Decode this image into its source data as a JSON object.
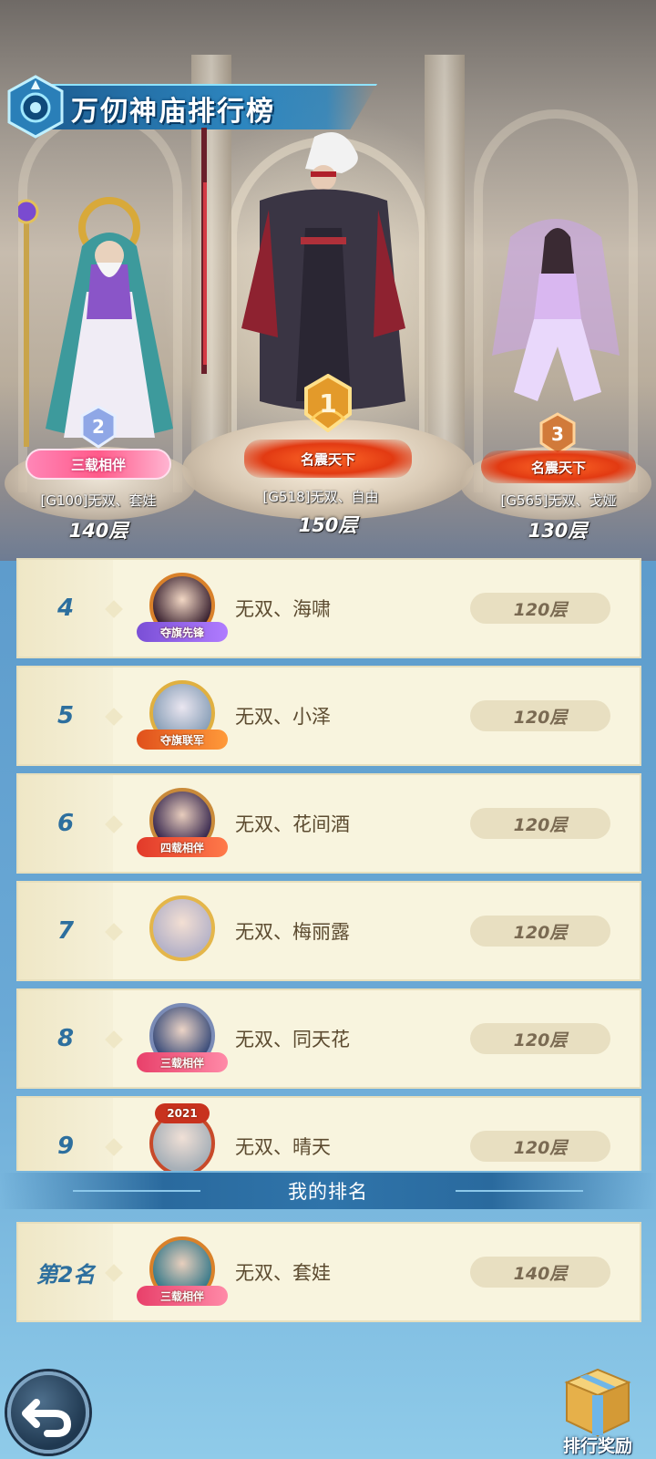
{
  "title": "万仞神庙排行榜",
  "top3": [
    {
      "rank": "2",
      "badge": "三载相伴",
      "name": "[G100]无双、套娃",
      "score": "140层"
    },
    {
      "rank": "1",
      "badge": "名震天下",
      "name": "[G518]无双、自由",
      "score": "150层"
    },
    {
      "rank": "3",
      "badge": "名震天下",
      "name": "[G565]无双、戈娅",
      "score": "130层"
    }
  ],
  "list": [
    {
      "rank": "4",
      "name": "无双、海啸",
      "score": "120层",
      "badge": "夺旗先锋"
    },
    {
      "rank": "5",
      "name": "无双、小泽",
      "score": "120层",
      "badge": "夺旗联军"
    },
    {
      "rank": "6",
      "name": "无双、花间酒",
      "score": "120层",
      "badge": "四载相伴"
    },
    {
      "rank": "7",
      "name": "无双、梅丽露",
      "score": "120层",
      "badge": ""
    },
    {
      "rank": "8",
      "name": "无双、同天花",
      "score": "120层",
      "badge": "三载相伴"
    },
    {
      "rank": "9",
      "name": "无双、晴天",
      "score": "120层",
      "badge": "2021"
    }
  ],
  "my_rank": {
    "header": "我的排名",
    "rank": "第2名",
    "name": "无双、套娃",
    "score": "140层",
    "badge": "三载相伴"
  },
  "buttons": {
    "reward_label": "排行奖励"
  },
  "colors": {
    "accent": "#2d6f9e",
    "row_bg": "#f8f4de",
    "score_pill": "#e8dfc1"
  }
}
